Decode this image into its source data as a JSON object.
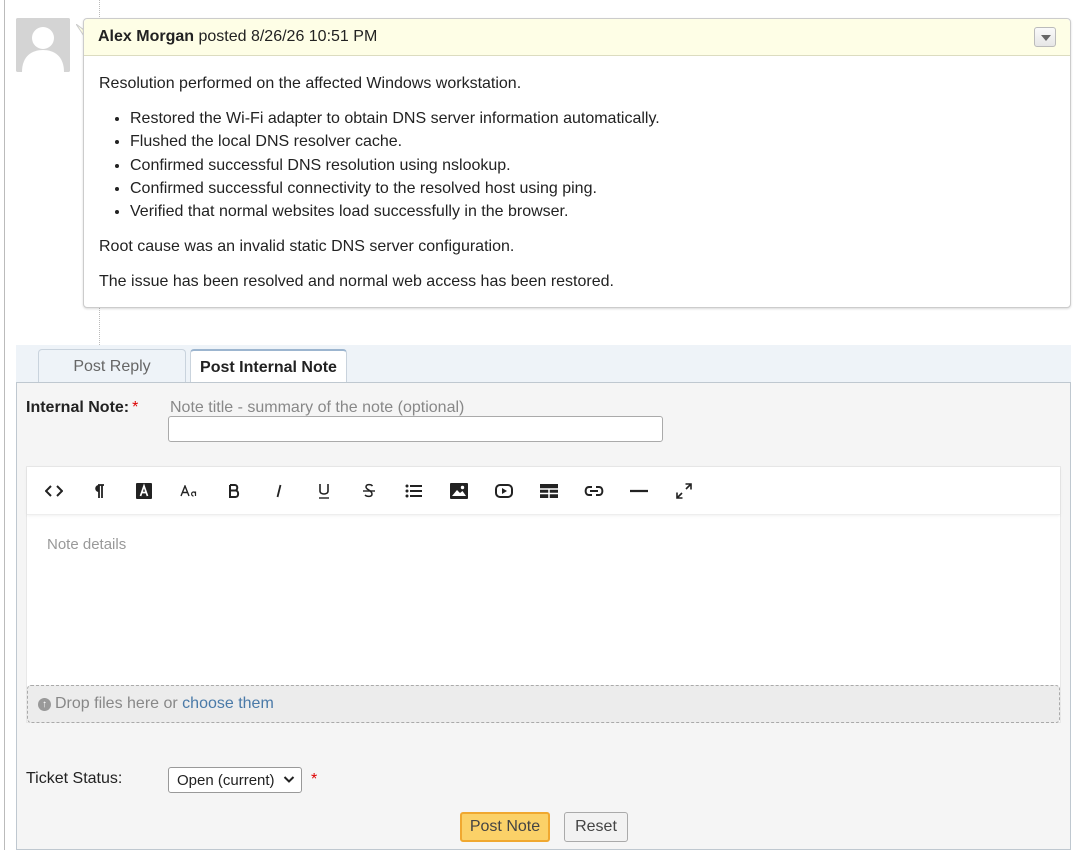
{
  "entry": {
    "author": "Alex Morgan",
    "posted_text": "posted 8/26/26 10:51 PM",
    "intro": "Resolution performed on the affected Windows workstation.",
    "steps": [
      "Restored the Wi-Fi adapter to obtain DNS server information automatically.",
      "Flushed the local DNS resolver cache.",
      "Confirmed successful DNS resolution using nslookup.",
      "Confirmed successful connectivity to the resolved host using ping.",
      "Verified that normal websites load successfully in the browser."
    ],
    "root_cause": "Root cause was an invalid static DNS server configuration.",
    "conclusion": "The issue has been resolved and normal web access has been restored."
  },
  "tabs": {
    "reply": "Post Reply",
    "note": "Post Internal Note"
  },
  "form": {
    "note_label": "Internal Note:",
    "required_mark": "*",
    "title_placeholder": "Note title - summary of the note (optional)",
    "title_value": "",
    "editor_placeholder": "Note details",
    "dropzone_text": "Drop files here or",
    "dropzone_link": "choose them",
    "status_label": "Ticket Status:",
    "status_value": "Open (current)",
    "post_button": "Post Note",
    "reset_button": "Reset"
  },
  "toolbar_icons": [
    "code-view-icon",
    "paragraph-icon",
    "text-color-icon",
    "font-size-icon",
    "bold-icon",
    "italic-icon",
    "underline-icon",
    "strikethrough-icon",
    "list-icon",
    "image-icon",
    "video-icon",
    "table-icon",
    "link-icon",
    "horizontal-rule-icon",
    "fullscreen-icon"
  ],
  "colors": {
    "entry_header_bg": "#fefee6",
    "post_button_bg": "#fbd168",
    "link": "#4a7aa8",
    "required": "#dd0000"
  }
}
